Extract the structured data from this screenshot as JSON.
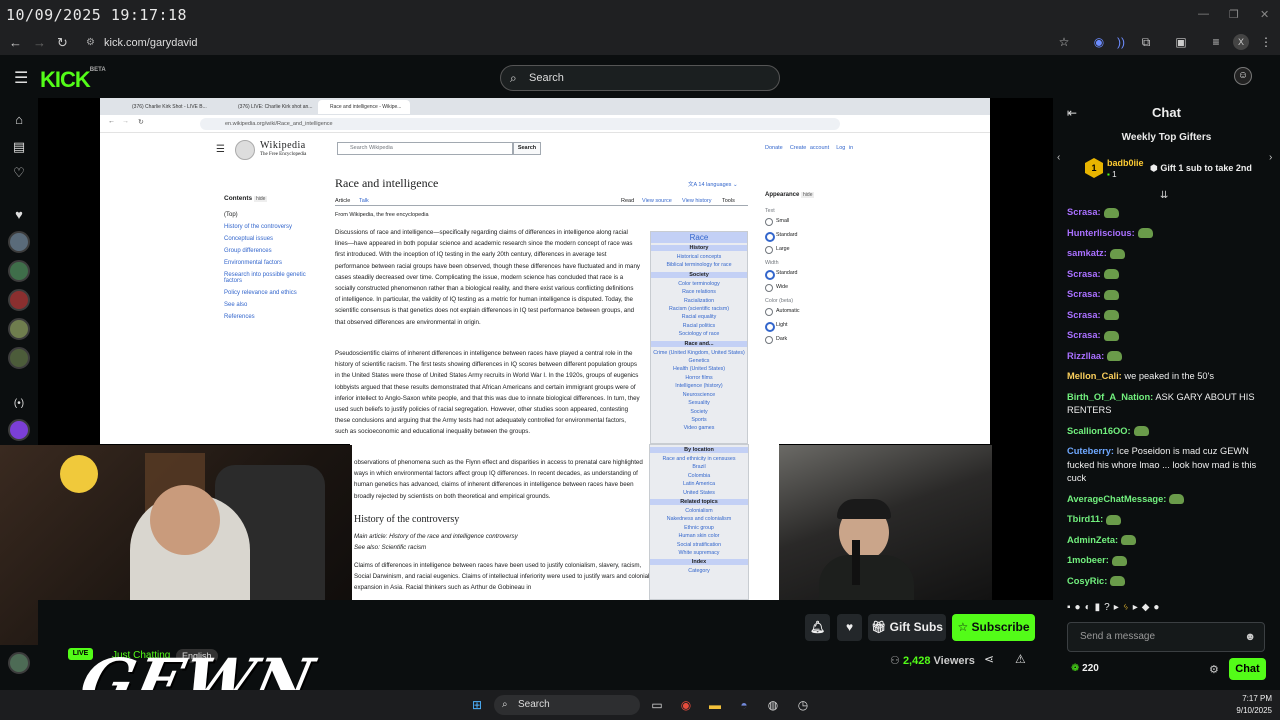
{
  "overlay": {
    "timestamp": "10/09/2025 19:17:18"
  },
  "browser": {
    "url": "kick.com/garydavid"
  },
  "kick": {
    "logo": "KICK",
    "logo_badge": "BETA",
    "search_placeholder": "Search"
  },
  "stream": {
    "wiki_tabs": [
      "(376) Charlie Kirk Shot - LIVE B...",
      "(376) LIVE: Charlie Kirk shot an...",
      "Race and intelligence - Wikipe..."
    ],
    "wiki_url": "en.wikipedia.org/wiki/Race_and_intelligence",
    "wiki_brand": "Wikipedia",
    "wiki_tagline": "The Free Encyclopedia",
    "wiki_search_placeholder": "Search Wikipedia",
    "wiki_search_btn": "Search",
    "wiki_top_links": [
      "Donate",
      "Create account",
      "Log in"
    ],
    "article_title": "Race and intelligence",
    "languages": "14 languages",
    "article_tabs": [
      "Article",
      "Talk"
    ],
    "view_tabs": [
      "Read",
      "View source",
      "View history",
      "Tools"
    ],
    "from": "From Wikipedia, the free encyclopedia",
    "contents_title": "Contents",
    "contents_hide": "hide",
    "contents": [
      "(Top)",
      "History of the controversy",
      "Conceptual issues",
      "Group differences",
      "Environmental factors",
      "Research into possible genetic factors",
      "Policy relevance and ethics",
      "See also",
      "References"
    ],
    "para1": "Discussions of race and intelligence—specifically regarding claims of differences in intelligence along racial lines—have appeared in both popular science and academic research since the modern concept of race was first introduced. With the inception of IQ testing in the early 20th century, differences in average test performance between racial groups have been observed, though these differences have fluctuated and in many cases steadily decreased over time. Complicating the issue, modern science has concluded that race is a socially constructed phenomenon rather than a biological reality, and there exist various conflicting definitions of intelligence. In particular, the validity of IQ testing as a metric for human intelligence is disputed. Today, the scientific consensus is that genetics does not explain differences in IQ test performance between groups, and that observed differences are environmental in origin.",
    "para2": "Pseudoscientific claims of inherent differences in intelligence between races have played a central role in the history of scientific racism. The first tests showing differences in IQ scores between different population groups in the United States were those of United States Army recruits in World War I. In the 1920s, groups of eugenics lobbyists argued that these results demonstrated that African Americans and certain immigrant groups were of inferior intellect to Anglo-Saxon white people, and that this was due to innate biological differences. In turn, they used such beliefs to justify policies of racial segregation. However, other studies soon appeared, contesting these conclusions and arguing that the Army tests had not adequately controlled for environmental factors, such as socioeconomic and educational inequality between the groups.",
    "para3": "observations of phenomena such as the Flynn effect and disparities in access to prenatal care highlighted ways in which environmental factors affect group IQ differences. In recent decades, as understanding of human genetics has advanced, claims of inherent differences in intelligence between races have been broadly rejected by scientists on both theoretical and empirical grounds.",
    "section2": "History of the controversy",
    "main_article": "Main article: History of the race and intelligence controversy",
    "see_also": "See also: Scientific racism",
    "para4": "Claims of differences in intelligence between races have been used to justify colonialism, slavery, racism, Social Darwinism, and racial eugenics. Claims of intellectual inferiority were used to justify wars and colonial expansion in Asia. Racial thinkers such as Arthur de Gobineau in",
    "infobox_title": "Race",
    "infobox": [
      {
        "h": "History",
        "items": [
          "Historical concepts",
          "Biblical terminology for race"
        ]
      },
      {
        "h": "Society",
        "items": [
          "Color terminology",
          "Race relations",
          "Racialization",
          "Racism (scientific racism)",
          "Racial equality",
          "Racial politics",
          "Sociology of race"
        ]
      },
      {
        "h": "Race and...",
        "items": [
          "Crime (United Kingdom, United States)",
          "Genetics",
          "Health (United States)",
          "Horror films",
          "Intelligence (history)",
          "Neuroscience",
          "Sexuality",
          "Society",
          "Sports",
          "Video games"
        ]
      },
      {
        "h": "By location",
        "items": [
          "Race and ethnicity in censuses",
          "Brazil",
          "Colombia",
          "Latin America",
          "United States"
        ]
      },
      {
        "h": "Related topics",
        "items": [
          "Colonialism",
          "Nakedness and colonialism",
          "Ethnic group",
          "Human skin color",
          "Social stratification",
          "White supremacy"
        ]
      },
      {
        "h": "Index",
        "items": [
          "Category"
        ]
      }
    ],
    "appearance_title": "Appearance",
    "appearance_hide": "hide",
    "appearance": [
      {
        "label": "Text",
        "opts": [
          "Small",
          "Standard",
          "Large"
        ],
        "sel": 1
      },
      {
        "label": "Width",
        "opts": [
          "Standard",
          "Wide"
        ],
        "sel": 0
      },
      {
        "label": "Color (beta)",
        "opts": [
          "Automatic",
          "Light",
          "Dark"
        ],
        "sel": 1
      }
    ]
  },
  "controls": {
    "gift_subs": "Gift Subs",
    "subscribe": "Subscribe",
    "viewers_count": "2,428",
    "viewers_label": "Viewers",
    "live": "LIVE",
    "category": "Just Chatting",
    "language": "English",
    "overlay_brand": "GEWN"
  },
  "chat": {
    "title": "Chat",
    "weekly_title": "Weekly Top Gifters",
    "gifter_rank": "1",
    "gifter_name": "badb0iie",
    "gifter_count": "1",
    "gift_cta": "Gift 1 sub to take 2nd",
    "messages": [
      {
        "user": "Scrasa:",
        "color": "#a970ff",
        "text": "",
        "emote": true
      },
      {
        "user": "Hunterliscious:",
        "color": "#a970ff",
        "text": "",
        "emote": true
      },
      {
        "user": "samkatz:",
        "color": "#a970ff",
        "text": "",
        "emote": true
      },
      {
        "user": "Scrasa:",
        "color": "#a970ff",
        "text": "",
        "emote": true
      },
      {
        "user": "Scrasa:",
        "color": "#a970ff",
        "text": "",
        "emote": true
      },
      {
        "user": "Scrasa:",
        "color": "#a970ff",
        "text": "",
        "emote": true
      },
      {
        "user": "Scrasa:",
        "color": "#a970ff",
        "text": "",
        "emote": true
      },
      {
        "user": "Rizzllaa:",
        "color": "#a970ff",
        "text": "",
        "emote": true
      },
      {
        "user": "Mellon_Cali:",
        "color": "#fbcf5c",
        "text": "we peaked in the 50's",
        "emote": false
      },
      {
        "user": "Birth_Of_A_Nation:",
        "color": "#72f07e",
        "text": "ASK GARY ABOUT HIS RENTERS",
        "emote": false
      },
      {
        "user": "Scallion16OO:",
        "color": "#72f07e",
        "text": "",
        "emote": true
      },
      {
        "user": "Cuteberry:",
        "color": "#6fa8ff",
        "text": "Ice Poseidon is mad cuz GEWN fucked his whore lmao ... look how mad is this cuck",
        "emote": false
      },
      {
        "user": "AverageChatMessage:",
        "color": "#72f07e",
        "text": "",
        "emote": true
      },
      {
        "user": "Tbird11:",
        "color": "#72f07e",
        "text": "",
        "emote": true
      },
      {
        "user": "AdminZeta:",
        "color": "#72f07e",
        "text": "",
        "emote": true
      },
      {
        "user": "1mobeer:",
        "color": "#72f07e",
        "text": "",
        "emote": true
      },
      {
        "user": "CosyRic:",
        "color": "#72f07e",
        "text": "",
        "emote": true
      }
    ],
    "input_placeholder": "Send a message",
    "points": "220",
    "send": "Chat"
  },
  "taskbar": {
    "search": "Search",
    "time": "7:17 PM",
    "date": "9/10/2025"
  },
  "colors": {
    "kick_green": "#53fc18",
    "bg": "#0b0e0f",
    "wiki_link": "#3366cc"
  }
}
